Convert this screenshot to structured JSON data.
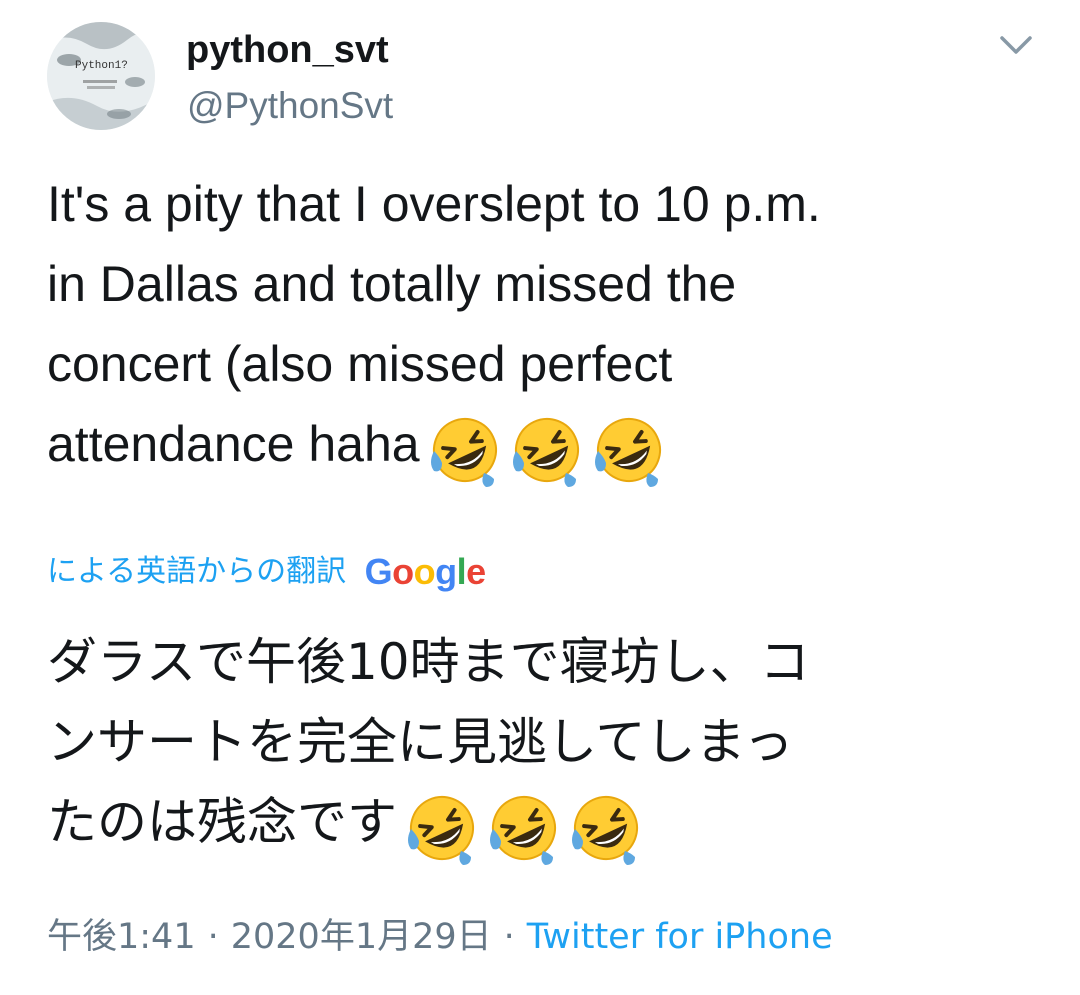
{
  "author": {
    "display_name": "python_svt",
    "handle": "@PythonSvt",
    "avatar_icon": "profile-avatar-image"
  },
  "menu": {
    "icon": "chevron-down-icon"
  },
  "tweet": {
    "lines": [
      "It's a pity that I overslept to 10 p.m.",
      "in Dallas and totally missed the",
      "concert (also missed perfect",
      "attendance haha"
    ],
    "emoji": "rolling-on-floor-laughing-emoji",
    "emoji_count": 3
  },
  "translation": {
    "label": "による英語からの翻訳",
    "provider": "Google",
    "lines": [
      "ダラスで午後10時まで寝坊し、コ",
      "ンサートを完全に見逃してしまっ",
      "たのは残念です"
    ]
  },
  "meta": {
    "time": "午後1:41",
    "date": "2020年1月29日",
    "separator": "·",
    "source": "Twitter for iPhone"
  },
  "colors": {
    "accent": "#1da1f2",
    "secondary_text": "#657786",
    "primary_text": "#14171a",
    "google_blue": "#4285F4",
    "google_red": "#EA4335",
    "google_yellow": "#FBBC05",
    "google_green": "#34A853"
  }
}
